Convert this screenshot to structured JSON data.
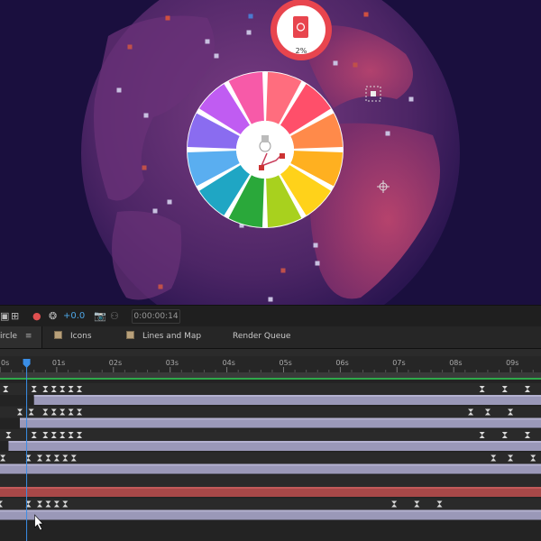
{
  "composition": {
    "badge_percent": "2%",
    "donut_colors": [
      "#ff6d7e",
      "#ff4f6a",
      "#ff8a4a",
      "#ffb020",
      "#ffd21a",
      "#a8d11e",
      "#2aa83a",
      "#1fa6c4",
      "#5aaef0",
      "#8a6cf0",
      "#c05cf2",
      "#f75aa8"
    ],
    "background_color": "#1a0f3e",
    "globe_color": "#5a2a6a",
    "badge_color": "#e8454e"
  },
  "toolbar": {
    "exposure_value": "+0.0",
    "timecode": "0:00:00:14"
  },
  "tabs": [
    {
      "label": "ircle",
      "active": true,
      "menu_icon": "≡"
    },
    {
      "label": "Icons",
      "active": false
    },
    {
      "label": "Lines and Map",
      "active": false
    },
    {
      "label": "Render Queue",
      "active": false
    }
  ],
  "timeline": {
    "ruler_labels": [
      "0s",
      "01s",
      "02s",
      "03s",
      "04s",
      "05s",
      "06s",
      "07s",
      "08s",
      "09s"
    ],
    "playhead_seconds": 0.47,
    "layers": [
      {
        "bar": "lavender",
        "start": 0.6,
        "keyframes": [
          0.1,
          0.6,
          0.8,
          0.95,
          1.1,
          1.25,
          1.4,
          8.5,
          8.9,
          9.3
        ]
      },
      {
        "bar": "lavender",
        "start": 0.35,
        "keyframes": [
          0.35,
          0.55,
          0.8,
          0.95,
          1.1,
          1.25,
          1.4,
          8.3,
          8.6,
          9.0
        ]
      },
      {
        "bar": "lavender",
        "start": 0.15,
        "keyframes": [
          0.15,
          0.6,
          0.8,
          0.95,
          1.1,
          1.25,
          1.4,
          8.5,
          8.9,
          9.3
        ]
      },
      {
        "bar": "lavender",
        "start": 0.0,
        "keyframes": [
          0.05,
          0.5,
          0.7,
          0.85,
          1.0,
          1.15,
          1.3,
          8.7,
          9.0,
          9.4
        ]
      },
      {
        "bar": "red",
        "start": 0.0,
        "keyframes": []
      },
      {
        "bar": "lavender",
        "start": 0.0,
        "keyframes": [
          0.0,
          0.5,
          0.7,
          0.85,
          1.0,
          1.15,
          6.95,
          7.35,
          7.75
        ]
      }
    ]
  }
}
